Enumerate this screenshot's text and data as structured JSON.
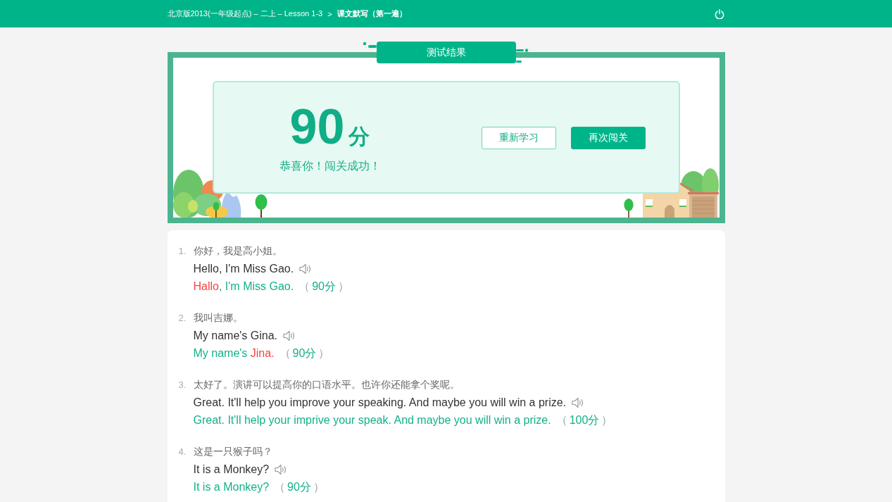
{
  "header": {
    "breadcrumb": "北京版2013(一年级起点) – 二上 – Lesson 1-3",
    "separator": ">",
    "current": "课文默写（第一遍）"
  },
  "result": {
    "title": "测试结果",
    "score": "90",
    "unit": "分",
    "message": "恭喜你！闯关成功！",
    "buttons": [
      {
        "label": "重新学习",
        "kind": "outline"
      },
      {
        "label": "再次闯关",
        "kind": "primary"
      }
    ]
  },
  "questions": [
    {
      "number": "1.",
      "chinese": "你好，我是高小姐。",
      "english": "Hello, I'm Miss Gao.",
      "answer": [
        {
          "text": "Hallo",
          "correct": false
        },
        {
          "text": ", I'm Miss Gao.",
          "correct": true
        }
      ],
      "score": {
        "open": "（",
        "value": "90分",
        "close": "）"
      }
    },
    {
      "number": "2.",
      "chinese": "我叫吉娜。",
      "english": "My name's Gina.",
      "answer": [
        {
          "text": "My name's ",
          "correct": true
        },
        {
          "text": "Jina.",
          "correct": false
        }
      ],
      "score": {
        "open": "（",
        "value": "90分",
        "close": "）"
      }
    },
    {
      "number": "3.",
      "chinese": "太好了。演讲可以提高你的口语水平。也许你还能拿个奖呢。",
      "english": "Great. It'll help you improve your speaking. And maybe you will win a prize.",
      "answer": [
        {
          "text": "Great. It'll help your imprive your speak. And maybe you will win a prize.",
          "correct": true
        }
      ],
      "score": {
        "open": "（",
        "value": "100分",
        "close": "）"
      }
    },
    {
      "number": "4.",
      "chinese": "这是一只猴子吗？",
      "english": "It is a Monkey?",
      "answer": [
        {
          "text": "It is a Monkey?",
          "correct": true
        }
      ],
      "score": {
        "open": "（",
        "value": "90分",
        "close": "）"
      }
    }
  ]
}
